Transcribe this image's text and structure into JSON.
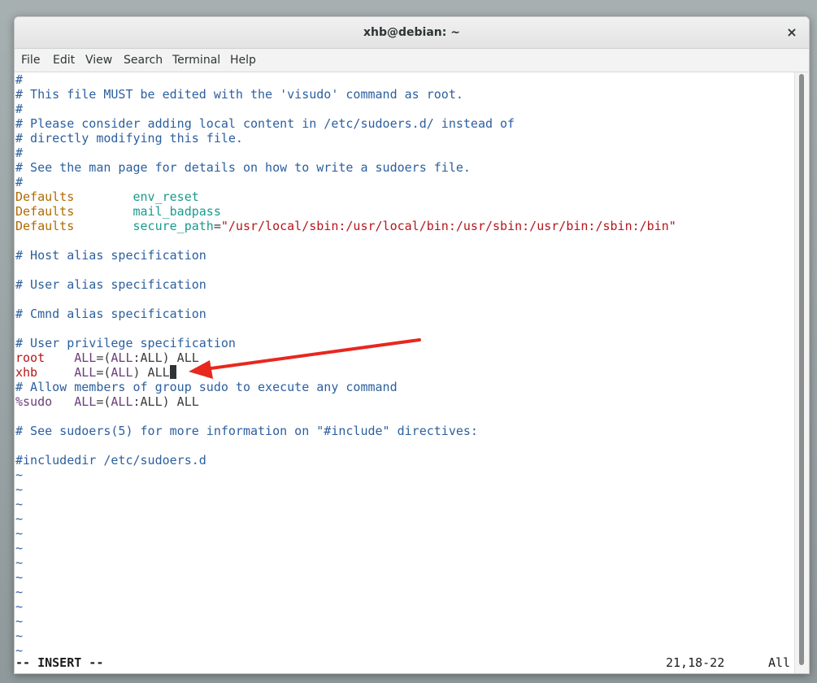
{
  "window": {
    "title": "xhb@debian: ~",
    "close_glyph": "×"
  },
  "menu": [
    "File",
    "Edit",
    "View",
    "Search",
    "Terminal",
    "Help"
  ],
  "lines": [
    [
      {
        "t": "#",
        "c": "comment"
      }
    ],
    [
      {
        "t": "# This file MUST be edited with the 'visudo' command as root.",
        "c": "comment"
      }
    ],
    [
      {
        "t": "#",
        "c": "comment"
      }
    ],
    [
      {
        "t": "# Please consider adding local content in /etc/sudoers.d/ instead of",
        "c": "comment"
      }
    ],
    [
      {
        "t": "# directly modifying this file.",
        "c": "comment"
      }
    ],
    [
      {
        "t": "#",
        "c": "comment"
      }
    ],
    [
      {
        "t": "# See the man page for details on how to write a sudoers file.",
        "c": "comment"
      }
    ],
    [
      {
        "t": "#",
        "c": "comment"
      }
    ],
    [
      {
        "t": "Defaults",
        "c": "keyword"
      },
      {
        "t": "        ",
        "c": "plain"
      },
      {
        "t": "env_reset",
        "c": "option"
      }
    ],
    [
      {
        "t": "Defaults",
        "c": "keyword"
      },
      {
        "t": "        ",
        "c": "plain"
      },
      {
        "t": "mail_badpass",
        "c": "option"
      }
    ],
    [
      {
        "t": "Defaults",
        "c": "keyword"
      },
      {
        "t": "        ",
        "c": "plain"
      },
      {
        "t": "secure_path",
        "c": "option"
      },
      {
        "t": "=",
        "c": "plain"
      },
      {
        "t": "\"/usr/local/sbin:/usr/local/bin:/usr/sbin:/usr/bin:/sbin:/bin\"",
        "c": "string"
      }
    ],
    [
      {
        "t": "",
        "c": "plain"
      }
    ],
    [
      {
        "t": "# Host alias specification",
        "c": "comment"
      }
    ],
    [
      {
        "t": "",
        "c": "plain"
      }
    ],
    [
      {
        "t": "# User alias specification",
        "c": "comment"
      }
    ],
    [
      {
        "t": "",
        "c": "plain"
      }
    ],
    [
      {
        "t": "# Cmnd alias specification",
        "c": "comment"
      }
    ],
    [
      {
        "t": "",
        "c": "plain"
      }
    ],
    [
      {
        "t": "# User privilege specification",
        "c": "comment"
      }
    ],
    [
      {
        "t": "root",
        "c": "user"
      },
      {
        "t": "    ",
        "c": "plain"
      },
      {
        "t": "ALL",
        "c": "alias"
      },
      {
        "t": "=(",
        "c": "plain"
      },
      {
        "t": "ALL",
        "c": "alias"
      },
      {
        "t": ":ALL) ALL",
        "c": "plain"
      }
    ],
    [
      {
        "t": "xhb",
        "c": "user"
      },
      {
        "t": "     ",
        "c": "plain"
      },
      {
        "t": "ALL",
        "c": "alias"
      },
      {
        "t": "=(",
        "c": "plain"
      },
      {
        "t": "ALL",
        "c": "alias"
      },
      {
        "t": ") ALL",
        "c": "plain"
      },
      {
        "t": "",
        "c": "cursor"
      }
    ],
    [
      {
        "t": "# Allow members of group sudo to execute any command",
        "c": "comment"
      }
    ],
    [
      {
        "t": "%sudo",
        "c": "alias"
      },
      {
        "t": "   ",
        "c": "plain"
      },
      {
        "t": "ALL",
        "c": "alias"
      },
      {
        "t": "=(",
        "c": "plain"
      },
      {
        "t": "ALL",
        "c": "alias"
      },
      {
        "t": ":ALL) ALL",
        "c": "plain"
      }
    ],
    [
      {
        "t": "",
        "c": "plain"
      }
    ],
    [
      {
        "t": "# See sudoers(5) for more information on \"#include\" directives:",
        "c": "comment"
      }
    ],
    [
      {
        "t": "",
        "c": "plain"
      }
    ],
    [
      {
        "t": "#includedir /etc/sudoers.d",
        "c": "comment"
      }
    ],
    [
      {
        "t": "~",
        "c": "tilde"
      }
    ],
    [
      {
        "t": "~",
        "c": "tilde"
      }
    ],
    [
      {
        "t": "~",
        "c": "tilde"
      }
    ],
    [
      {
        "t": "~",
        "c": "tilde"
      }
    ],
    [
      {
        "t": "~",
        "c": "tilde"
      }
    ],
    [
      {
        "t": "~",
        "c": "tilde"
      }
    ],
    [
      {
        "t": "~",
        "c": "tilde"
      }
    ],
    [
      {
        "t": "~",
        "c": "tilde"
      }
    ],
    [
      {
        "t": "~",
        "c": "tilde"
      }
    ],
    [
      {
        "t": "~",
        "c": "tilde"
      }
    ],
    [
      {
        "t": "~",
        "c": "tilde"
      }
    ],
    [
      {
        "t": "~",
        "c": "tilde"
      }
    ],
    [
      {
        "t": "~",
        "c": "tilde"
      }
    ]
  ],
  "status": {
    "mode": "-- INSERT --",
    "position": "21,18-22",
    "scroll": "All"
  },
  "colors": {
    "comment": "#2c5f9e",
    "keyword": "#b06a00",
    "option": "#1a9a8d",
    "string": "#b5161b",
    "user": "#b5161b",
    "alias": "#6b3e7a",
    "annotation_arrow": "#e8271e"
  },
  "icons": {
    "close": "close-icon",
    "annotation": "red-arrow-icon"
  }
}
